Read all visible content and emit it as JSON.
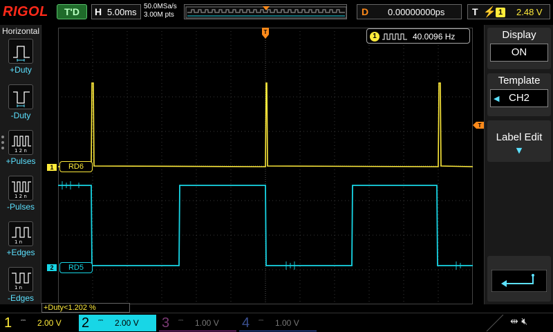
{
  "header": {
    "brand": "RIGOL",
    "run_state": "T'D",
    "timebase_letter": "H",
    "timebase": "5.00ms",
    "sample_rate": "50.0MSa/s",
    "memory_depth": "3.00M pts",
    "delay_letter": "D",
    "delay": "0.00000000ps",
    "trigger_letter": "T",
    "trigger_source": "1",
    "trigger_level": "2.48 V",
    "colors": {
      "brand": "#ff2a1a",
      "run_state": "#57c06a",
      "delay": "#ff8a1a"
    }
  },
  "left_panel": {
    "title": "Horizontal",
    "items": [
      {
        "label": "+Duty",
        "icon": "positive-duty-icon"
      },
      {
        "label": "-Duty",
        "icon": "negative-duty-icon"
      },
      {
        "label": "+Pulses",
        "icon": "positive-pulses-icon"
      },
      {
        "label": "-Pulses",
        "icon": "negative-pulses-icon"
      },
      {
        "label": "+Edges",
        "icon": "rising-edges-icon"
      },
      {
        "label": "-Edges",
        "icon": "falling-edges-icon"
      }
    ]
  },
  "display": {
    "frequency_channel": "1",
    "frequency": "40.0096 Hz",
    "measurement": "+Duty<1.202 %",
    "channels": [
      {
        "id": "1",
        "label": "RD6",
        "color": "#ffeb3b"
      },
      {
        "id": "2",
        "label": "RD5",
        "color": "#18d6e6"
      }
    ],
    "trigger_marker": "T"
  },
  "right_panel": {
    "display": {
      "title": "Display",
      "value": "ON"
    },
    "template": {
      "title": "Template",
      "value": "CH2"
    },
    "label_edit": {
      "title": "Label Edit"
    },
    "enter_icon": "enter-arrow-icon"
  },
  "bottom": {
    "channels": [
      {
        "num": "1",
        "coupling": "DC",
        "scale": "2.00 V",
        "color": "#ffeb3b",
        "active": true
      },
      {
        "num": "2",
        "coupling": "DC",
        "scale": "2.00 V",
        "color": "#18d6e6",
        "active": true
      },
      {
        "num": "3",
        "coupling": "DC",
        "scale": "1.00 V",
        "color": "#b03aa8",
        "active": false
      },
      {
        "num": "4",
        "coupling": "DC",
        "scale": "1.00 V",
        "color": "#3a5fd0",
        "active": false
      }
    ],
    "icons": [
      "usb-icon",
      "speaker-mute-icon"
    ]
  }
}
